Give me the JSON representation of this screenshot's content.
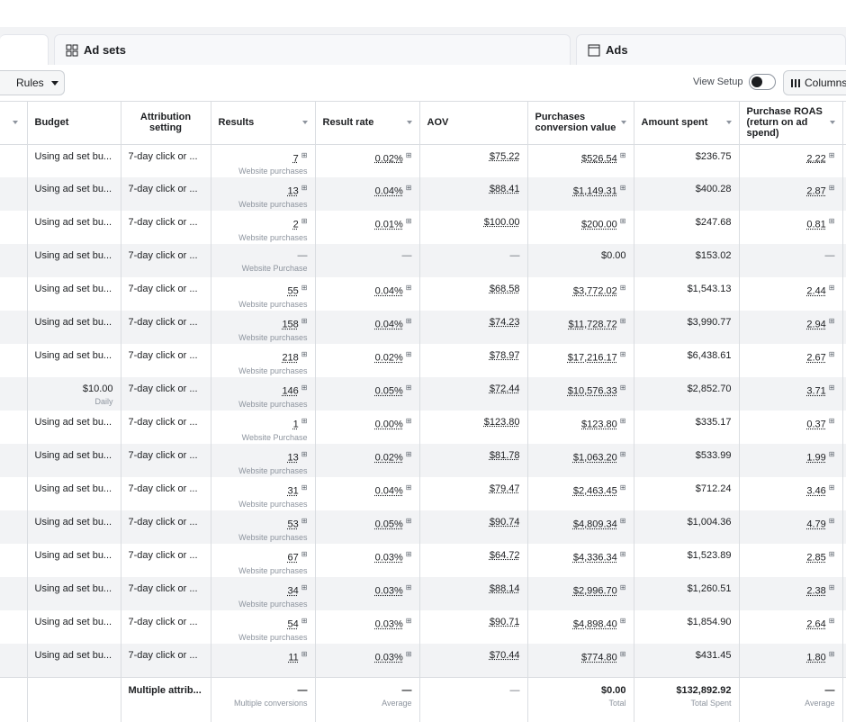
{
  "tabs": {
    "ad_sets_label": "Ad sets",
    "ads_label": "Ads"
  },
  "toolbar": {
    "rules_label": "Rules",
    "view_setup_label": "View Setup",
    "columns_label": "Columns"
  },
  "table": {
    "headers": {
      "budget": "Budget",
      "attribution": "Attribution setting",
      "results": "Results",
      "result_rate": "Result rate",
      "aov": "AOV",
      "purchases_value": "Purchases conversion value",
      "amount_spent": "Amount spent",
      "purchase_roas": "Purchase ROAS (return on ad spend)"
    },
    "rows": [
      {
        "budget": "Using ad set bu...",
        "budget_sub": "",
        "attribution": "7-day click or ...",
        "results": "7",
        "results_sub": "Website purchases",
        "result_rate": "0.02%",
        "aov": "$75.22",
        "purchases_value": "$526.54",
        "amount_spent": "$236.75",
        "roas": "2.22"
      },
      {
        "budget": "Using ad set bu...",
        "budget_sub": "",
        "attribution": "7-day click or ...",
        "results": "13",
        "results_sub": "Website purchases",
        "result_rate": "0.04%",
        "aov": "$88.41",
        "purchases_value": "$1,149.31",
        "amount_spent": "$400.28",
        "roas": "2.87"
      },
      {
        "budget": "Using ad set bu...",
        "budget_sub": "",
        "attribution": "7-day click or ...",
        "results": "2",
        "results_sub": "Website purchases",
        "result_rate": "0.01%",
        "aov": "$100.00",
        "purchases_value": "$200.00",
        "amount_spent": "$247.68",
        "roas": "0.81"
      },
      {
        "budget": "Using ad set bu...",
        "budget_sub": "",
        "attribution": "7-day click or ...",
        "results": "—",
        "results_sub": "Website Purchase",
        "result_rate": "—",
        "aov": "—",
        "purchases_value": "$0.00",
        "amount_spent": "$153.02",
        "roas": "—"
      },
      {
        "budget": "Using ad set bu...",
        "budget_sub": "",
        "attribution": "7-day click or ...",
        "results": "55",
        "results_sub": "Website purchases",
        "result_rate": "0.04%",
        "aov": "$68.58",
        "purchases_value": "$3,772.02",
        "amount_spent": "$1,543.13",
        "roas": "2.44"
      },
      {
        "budget": "Using ad set bu...",
        "budget_sub": "",
        "attribution": "7-day click or ...",
        "results": "158",
        "results_sub": "Website purchases",
        "result_rate": "0.04%",
        "aov": "$74.23",
        "purchases_value": "$11,728.72",
        "amount_spent": "$3,990.77",
        "roas": "2.94"
      },
      {
        "budget": "Using ad set bu...",
        "budget_sub": "",
        "attribution": "7-day click or ...",
        "results": "218",
        "results_sub": "Website purchases",
        "result_rate": "0.02%",
        "aov": "$78.97",
        "purchases_value": "$17,216.17",
        "amount_spent": "$6,438.61",
        "roas": "2.67"
      },
      {
        "budget": "$10.00",
        "budget_sub": "Daily",
        "attribution": "7-day click or ...",
        "results": "146",
        "results_sub": "Website purchases",
        "result_rate": "0.05%",
        "aov": "$72.44",
        "purchases_value": "$10,576.33",
        "amount_spent": "$2,852.70",
        "roas": "3.71"
      },
      {
        "budget": "Using ad set bu...",
        "budget_sub": "",
        "attribution": "7-day click or ...",
        "results": "1",
        "results_sub": "Website Purchase",
        "result_rate": "0.00%",
        "aov": "$123.80",
        "purchases_value": "$123.80",
        "amount_spent": "$335.17",
        "roas": "0.37"
      },
      {
        "budget": "Using ad set bu...",
        "budget_sub": "",
        "attribution": "7-day click or ...",
        "results": "13",
        "results_sub": "Website purchases",
        "result_rate": "0.02%",
        "aov": "$81.78",
        "purchases_value": "$1,063.20",
        "amount_spent": "$533.99",
        "roas": "1.99"
      },
      {
        "budget": "Using ad set bu...",
        "budget_sub": "",
        "attribution": "7-day click or ...",
        "results": "31",
        "results_sub": "Website purchases",
        "result_rate": "0.04%",
        "aov": "$79.47",
        "purchases_value": "$2,463.45",
        "amount_spent": "$712.24",
        "roas": "3.46"
      },
      {
        "budget": "Using ad set bu...",
        "budget_sub": "",
        "attribution": "7-day click or ...",
        "results": "53",
        "results_sub": "Website purchases",
        "result_rate": "0.05%",
        "aov": "$90.74",
        "purchases_value": "$4,809.34",
        "amount_spent": "$1,004.36",
        "roas": "4.79"
      },
      {
        "budget": "Using ad set bu...",
        "budget_sub": "",
        "attribution": "7-day click or ...",
        "results": "67",
        "results_sub": "Website purchases",
        "result_rate": "0.03%",
        "aov": "$64.72",
        "purchases_value": "$4,336.34",
        "amount_spent": "$1,523.89",
        "roas": "2.85"
      },
      {
        "budget": "Using ad set bu...",
        "budget_sub": "",
        "attribution": "7-day click or ...",
        "results": "34",
        "results_sub": "Website purchases",
        "result_rate": "0.03%",
        "aov": "$88.14",
        "purchases_value": "$2,996.70",
        "amount_spent": "$1,260.51",
        "roas": "2.38"
      },
      {
        "budget": "Using ad set bu...",
        "budget_sub": "",
        "attribution": "7-day click or ...",
        "results": "54",
        "results_sub": "Website purchases",
        "result_rate": "0.03%",
        "aov": "$90.71",
        "purchases_value": "$4,898.40",
        "amount_spent": "$1,854.90",
        "roas": "2.64"
      },
      {
        "budget": "Using ad set bu...",
        "budget_sub": "",
        "attribution": "7-day click or ...",
        "results": "11",
        "results_sub": "",
        "result_rate": "0.03%",
        "aov": "$70.44",
        "purchases_value": "$774.80",
        "amount_spent": "$431.45",
        "roas": "1.80"
      }
    ],
    "footer": {
      "attribution": "Multiple attrib...",
      "results": "—",
      "results_sub": "Multiple conversions",
      "result_rate": "—",
      "result_rate_sub": "Average",
      "aov": "—",
      "purchases_value": "$0.00",
      "purchases_value_sub": "Total",
      "amount_spent": "$132,892.92",
      "amount_spent_sub": "Total Spent",
      "roas": "—",
      "roas_sub": "Average"
    }
  },
  "colors": {
    "border": "#dadde1",
    "stripe": "#f2f3f5",
    "muted": "#8d949e"
  }
}
